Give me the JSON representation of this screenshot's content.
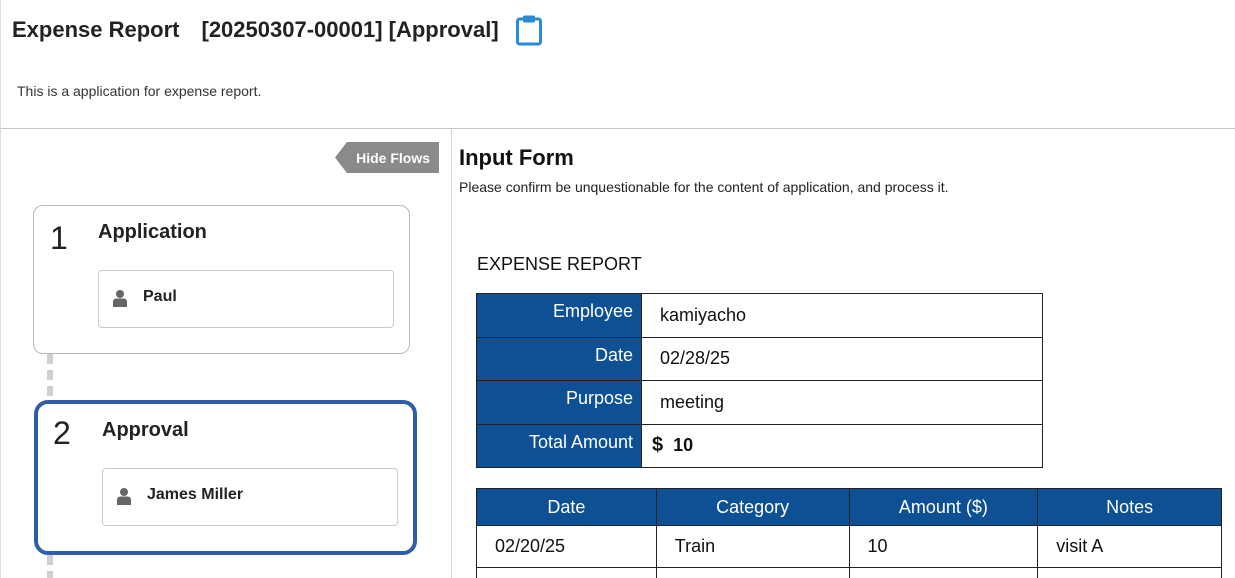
{
  "header": {
    "title": "Expense Report",
    "process_title": "[20250307-00001] [Approval]",
    "clipboard_icon": "clipboard-icon",
    "description": "This is a application for expense report."
  },
  "flows": {
    "hide_label": "Hide Flows",
    "steps": [
      {
        "number": "1",
        "name": "Application",
        "user": "Paul",
        "active": false
      },
      {
        "number": "2",
        "name": "Approval",
        "user": "James Miller",
        "active": true
      }
    ]
  },
  "form": {
    "title": "Input Form",
    "description": "Please confirm be unquestionable for the content of application, and process it.",
    "report_title": "EXPENSE REPORT",
    "fields": [
      {
        "label": "Employee",
        "value": "kamiyacho"
      },
      {
        "label": "Date",
        "value": "02/28/25"
      },
      {
        "label": "Purpose",
        "value": "meeting"
      },
      {
        "label": "Total Amount",
        "currency": "$",
        "value": "10"
      }
    ],
    "details": {
      "columns": [
        "Date",
        "Category",
        "Amount ($)",
        "Notes"
      ],
      "rows": [
        [
          "02/20/25",
          "Train",
          "10",
          "visit A"
        ]
      ]
    }
  },
  "colors": {
    "table_header": "#0d5093",
    "active_step_border": "#2f5da8",
    "clipboard_icon": "#2a8ad4"
  }
}
